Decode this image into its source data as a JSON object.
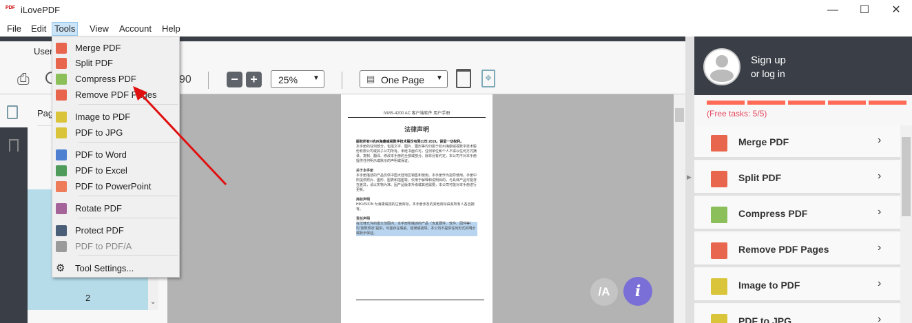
{
  "app": {
    "title": "iLovePDF"
  },
  "menubar": [
    "File",
    "Edit",
    "Tools",
    "View",
    "Account",
    "Help"
  ],
  "userrow": {
    "label": "User"
  },
  "leftpanel": {
    "pages_label": "Pag",
    "thumb_page": "2"
  },
  "toolbar": {
    "page_count": "90",
    "zoom": "25%",
    "view_mode": "One Page"
  },
  "tools_menu": [
    {
      "label": "Merge PDF",
      "color": "#e8664d",
      "enabled": true
    },
    {
      "label": "Split PDF",
      "color": "#e8664d",
      "enabled": true
    },
    {
      "label": "Compress PDF",
      "color": "#8bbf5a",
      "enabled": true
    },
    {
      "label": "Remove PDF Pages",
      "color": "#e8664d",
      "enabled": true
    },
    {
      "label": "Image to PDF",
      "color": "#d9c43a",
      "enabled": true
    },
    {
      "label": "PDF to JPG",
      "color": "#d9c43a",
      "enabled": true
    },
    {
      "label": "PDF to Word",
      "color": "#4f7fd1",
      "enabled": true
    },
    {
      "label": "PDF to Excel",
      "color": "#4e9b5b",
      "enabled": true
    },
    {
      "label": "PDF to PowerPoint",
      "color": "#ee7b5a",
      "enabled": true
    },
    {
      "label": "Rotate PDF",
      "color": "#a4649a",
      "enabled": true
    },
    {
      "label": "Protect PDF",
      "color": "#4a5e78",
      "enabled": true
    },
    {
      "label": "PDF to PDF/A",
      "color": "#9a9a9a",
      "enabled": false
    },
    {
      "label": "Tool Settings...",
      "color": "",
      "enabled": true
    }
  ],
  "document": {
    "header": "iVMS-4200 AC 客户端软件 用户手册",
    "title": "法律声明",
    "para1_bold": "版权所有©杭州海康威视数字技术股份有限公司 2019。保留一切权利。",
    "para1": "本手册的任何部分，包括文字、图片、图形等均归属于杭州海康威视数字技术股份有限公司或其子公司所有。未经书面许可，任何单位和个人不得以任何方式摘录、复制、翻译、修改本手册的全部或部分。除非另有约定，本公司不对本手册提供任何明示或默示的声明或保证。",
    "h2": "关于本手册",
    "para2": "本手册描述的产品仅供中国大陆地区销售和使用。本手册作为指导使用。手册中所提供照片、图形、图表和插图等，仅用于解释和说明目的，与具体产品可能存在差异，请以实物为准。因产品版本升级或其他需要，本公司可能对本手册进行更新。",
    "h3": "商标声明",
    "para3": "HIKVISION 为海康威视的注册商标。本手册涉及的其他商标由其所有人各自拥有。",
    "h4": "责任声明",
    "para4": "在法律允许的最大范围内，本手册所描述的产品（含其硬件、软件、固件等）均“按照现状”提供，可能存在瑕疵、错误或故障。本公司不提供任何形式的明示或默示保证。"
  },
  "rightpanel": {
    "signup": "Sign up",
    "login": "or log in",
    "free_tasks": "(Free tasks: 5/5)",
    "free_used": 5,
    "free_total": 5,
    "tools": [
      {
        "label": "Merge PDF",
        "color": "#e8664d"
      },
      {
        "label": "Split PDF",
        "color": "#e8664d"
      },
      {
        "label": "Compress PDF",
        "color": "#8bbf5a"
      },
      {
        "label": "Remove PDF Pages",
        "color": "#e8664d"
      },
      {
        "label": "Image to PDF",
        "color": "#d9c43a"
      },
      {
        "label": "PDF to JPG",
        "color": "#d9c43a"
      }
    ]
  },
  "floating": {
    "pdfa": "/A",
    "info": "i"
  }
}
